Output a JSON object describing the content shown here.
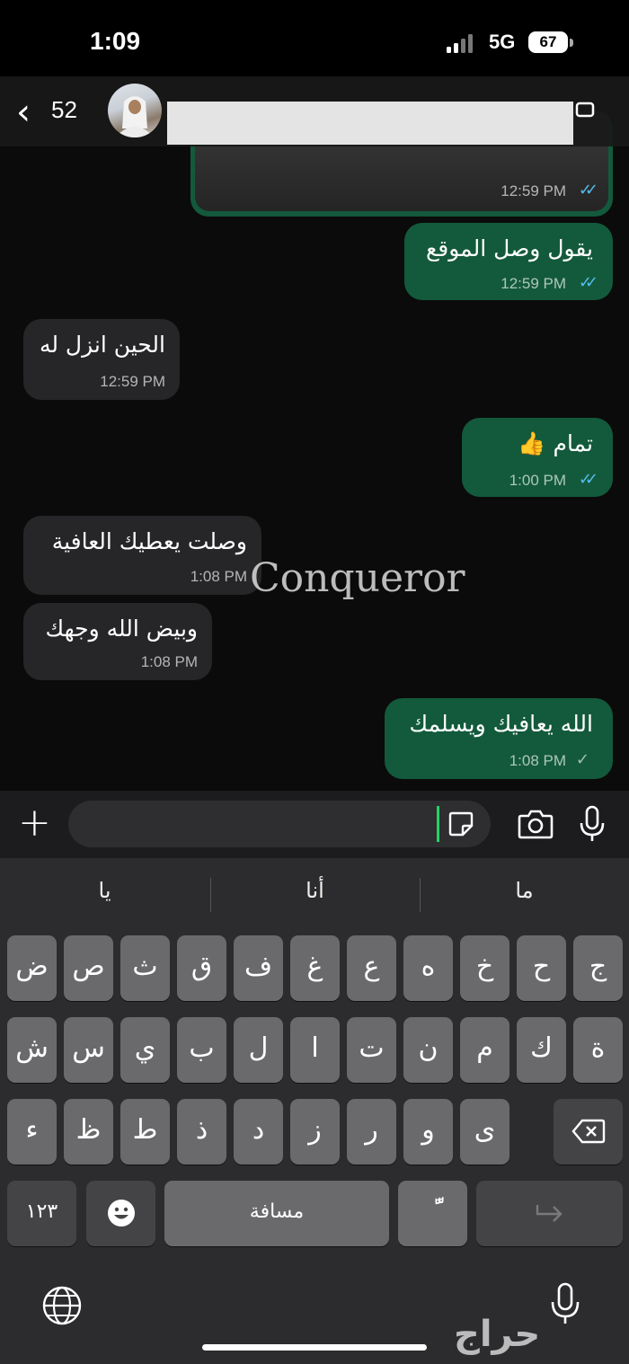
{
  "status_bar": {
    "time": "1:09",
    "network": "5G",
    "battery": "67"
  },
  "header": {
    "back_count": "52"
  },
  "messages": [
    {
      "dir": "out",
      "text": "",
      "time": "12:59 PM",
      "status": "read",
      "media": true
    },
    {
      "dir": "out",
      "text": "يقول وصل الموقع",
      "time": "12:59 PM",
      "status": "read"
    },
    {
      "dir": "in",
      "text": "الحين انزل له",
      "time": "12:59 PM"
    },
    {
      "dir": "out",
      "text": "تمام 👍",
      "time": "1:00 PM",
      "status": "read"
    },
    {
      "dir": "in",
      "text": "وصلت يعطيك العافية",
      "time": "1:08 PM"
    },
    {
      "dir": "in",
      "text": "وبيض الله وجهك",
      "time": "1:08 PM"
    },
    {
      "dir": "out",
      "text": "الله يعافيك ويسلمك",
      "time": "1:08 PM",
      "status": "sent"
    }
  ],
  "watermark": "Conqueror",
  "suggestions": [
    "يا",
    "أنا",
    "ما"
  ],
  "keyboard": {
    "row1": [
      "ض",
      "ص",
      "ث",
      "ق",
      "ف",
      "غ",
      "ع",
      "ه",
      "خ",
      "ح",
      "ج"
    ],
    "row2": [
      "ش",
      "س",
      "ي",
      "ب",
      "ل",
      "ا",
      "ت",
      "ن",
      "م",
      "ك",
      "ة"
    ],
    "row3": [
      "ء",
      "ظ",
      "ط",
      "ذ",
      "د",
      "ز",
      "ر",
      "و",
      "ى"
    ],
    "numbers_label": "١٢٣",
    "space_label": "مسافة",
    "diacritic_label": "ًّ"
  },
  "haraj_watermark": "حراج",
  "colors": {
    "outgoing_bubble": "#135a3c",
    "incoming_bubble": "#262628",
    "read_tick": "#53bdeb"
  }
}
